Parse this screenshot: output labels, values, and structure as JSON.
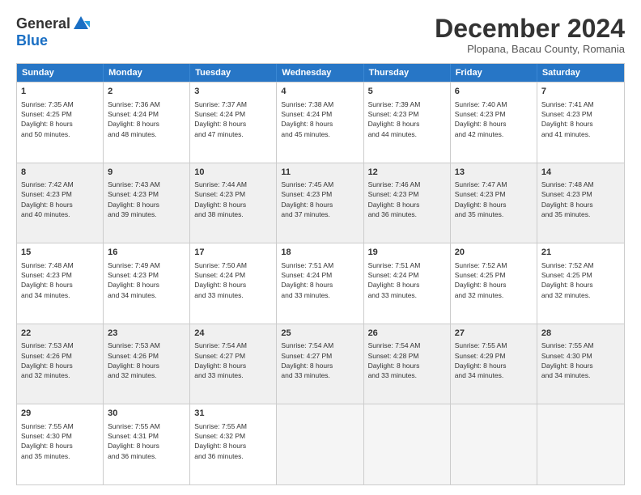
{
  "logo": {
    "general": "General",
    "blue": "Blue"
  },
  "title": "December 2024",
  "subtitle": "Plopana, Bacau County, Romania",
  "header_days": [
    "Sunday",
    "Monday",
    "Tuesday",
    "Wednesday",
    "Thursday",
    "Friday",
    "Saturday"
  ],
  "weeks": [
    [
      {
        "day": "1",
        "lines": [
          "Sunrise: 7:35 AM",
          "Sunset: 4:25 PM",
          "Daylight: 8 hours",
          "and 50 minutes."
        ],
        "shade": false
      },
      {
        "day": "2",
        "lines": [
          "Sunrise: 7:36 AM",
          "Sunset: 4:24 PM",
          "Daylight: 8 hours",
          "and 48 minutes."
        ],
        "shade": false
      },
      {
        "day": "3",
        "lines": [
          "Sunrise: 7:37 AM",
          "Sunset: 4:24 PM",
          "Daylight: 8 hours",
          "and 47 minutes."
        ],
        "shade": false
      },
      {
        "day": "4",
        "lines": [
          "Sunrise: 7:38 AM",
          "Sunset: 4:24 PM",
          "Daylight: 8 hours",
          "and 45 minutes."
        ],
        "shade": false
      },
      {
        "day": "5",
        "lines": [
          "Sunrise: 7:39 AM",
          "Sunset: 4:23 PM",
          "Daylight: 8 hours",
          "and 44 minutes."
        ],
        "shade": false
      },
      {
        "day": "6",
        "lines": [
          "Sunrise: 7:40 AM",
          "Sunset: 4:23 PM",
          "Daylight: 8 hours",
          "and 42 minutes."
        ],
        "shade": false
      },
      {
        "day": "7",
        "lines": [
          "Sunrise: 7:41 AM",
          "Sunset: 4:23 PM",
          "Daylight: 8 hours",
          "and 41 minutes."
        ],
        "shade": false
      }
    ],
    [
      {
        "day": "8",
        "lines": [
          "Sunrise: 7:42 AM",
          "Sunset: 4:23 PM",
          "Daylight: 8 hours",
          "and 40 minutes."
        ],
        "shade": true
      },
      {
        "day": "9",
        "lines": [
          "Sunrise: 7:43 AM",
          "Sunset: 4:23 PM",
          "Daylight: 8 hours",
          "and 39 minutes."
        ],
        "shade": true
      },
      {
        "day": "10",
        "lines": [
          "Sunrise: 7:44 AM",
          "Sunset: 4:23 PM",
          "Daylight: 8 hours",
          "and 38 minutes."
        ],
        "shade": true
      },
      {
        "day": "11",
        "lines": [
          "Sunrise: 7:45 AM",
          "Sunset: 4:23 PM",
          "Daylight: 8 hours",
          "and 37 minutes."
        ],
        "shade": true
      },
      {
        "day": "12",
        "lines": [
          "Sunrise: 7:46 AM",
          "Sunset: 4:23 PM",
          "Daylight: 8 hours",
          "and 36 minutes."
        ],
        "shade": true
      },
      {
        "day": "13",
        "lines": [
          "Sunrise: 7:47 AM",
          "Sunset: 4:23 PM",
          "Daylight: 8 hours",
          "and 35 minutes."
        ],
        "shade": true
      },
      {
        "day": "14",
        "lines": [
          "Sunrise: 7:48 AM",
          "Sunset: 4:23 PM",
          "Daylight: 8 hours",
          "and 35 minutes."
        ],
        "shade": true
      }
    ],
    [
      {
        "day": "15",
        "lines": [
          "Sunrise: 7:48 AM",
          "Sunset: 4:23 PM",
          "Daylight: 8 hours",
          "and 34 minutes."
        ],
        "shade": false
      },
      {
        "day": "16",
        "lines": [
          "Sunrise: 7:49 AM",
          "Sunset: 4:23 PM",
          "Daylight: 8 hours",
          "and 34 minutes."
        ],
        "shade": false
      },
      {
        "day": "17",
        "lines": [
          "Sunrise: 7:50 AM",
          "Sunset: 4:24 PM",
          "Daylight: 8 hours",
          "and 33 minutes."
        ],
        "shade": false
      },
      {
        "day": "18",
        "lines": [
          "Sunrise: 7:51 AM",
          "Sunset: 4:24 PM",
          "Daylight: 8 hours",
          "and 33 minutes."
        ],
        "shade": false
      },
      {
        "day": "19",
        "lines": [
          "Sunrise: 7:51 AM",
          "Sunset: 4:24 PM",
          "Daylight: 8 hours",
          "and 33 minutes."
        ],
        "shade": false
      },
      {
        "day": "20",
        "lines": [
          "Sunrise: 7:52 AM",
          "Sunset: 4:25 PM",
          "Daylight: 8 hours",
          "and 32 minutes."
        ],
        "shade": false
      },
      {
        "day": "21",
        "lines": [
          "Sunrise: 7:52 AM",
          "Sunset: 4:25 PM",
          "Daylight: 8 hours",
          "and 32 minutes."
        ],
        "shade": false
      }
    ],
    [
      {
        "day": "22",
        "lines": [
          "Sunrise: 7:53 AM",
          "Sunset: 4:26 PM",
          "Daylight: 8 hours",
          "and 32 minutes."
        ],
        "shade": true
      },
      {
        "day": "23",
        "lines": [
          "Sunrise: 7:53 AM",
          "Sunset: 4:26 PM",
          "Daylight: 8 hours",
          "and 32 minutes."
        ],
        "shade": true
      },
      {
        "day": "24",
        "lines": [
          "Sunrise: 7:54 AM",
          "Sunset: 4:27 PM",
          "Daylight: 8 hours",
          "and 33 minutes."
        ],
        "shade": true
      },
      {
        "day": "25",
        "lines": [
          "Sunrise: 7:54 AM",
          "Sunset: 4:27 PM",
          "Daylight: 8 hours",
          "and 33 minutes."
        ],
        "shade": true
      },
      {
        "day": "26",
        "lines": [
          "Sunrise: 7:54 AM",
          "Sunset: 4:28 PM",
          "Daylight: 8 hours",
          "and 33 minutes."
        ],
        "shade": true
      },
      {
        "day": "27",
        "lines": [
          "Sunrise: 7:55 AM",
          "Sunset: 4:29 PM",
          "Daylight: 8 hours",
          "and 34 minutes."
        ],
        "shade": true
      },
      {
        "day": "28",
        "lines": [
          "Sunrise: 7:55 AM",
          "Sunset: 4:30 PM",
          "Daylight: 8 hours",
          "and 34 minutes."
        ],
        "shade": true
      }
    ],
    [
      {
        "day": "29",
        "lines": [
          "Sunrise: 7:55 AM",
          "Sunset: 4:30 PM",
          "Daylight: 8 hours",
          "and 35 minutes."
        ],
        "shade": false
      },
      {
        "day": "30",
        "lines": [
          "Sunrise: 7:55 AM",
          "Sunset: 4:31 PM",
          "Daylight: 8 hours",
          "and 36 minutes."
        ],
        "shade": false
      },
      {
        "day": "31",
        "lines": [
          "Sunrise: 7:55 AM",
          "Sunset: 4:32 PM",
          "Daylight: 8 hours",
          "and 36 minutes."
        ],
        "shade": false
      },
      {
        "day": "",
        "lines": [],
        "shade": false,
        "empty": true
      },
      {
        "day": "",
        "lines": [],
        "shade": false,
        "empty": true
      },
      {
        "day": "",
        "lines": [],
        "shade": false,
        "empty": true
      },
      {
        "day": "",
        "lines": [],
        "shade": false,
        "empty": true
      }
    ]
  ]
}
